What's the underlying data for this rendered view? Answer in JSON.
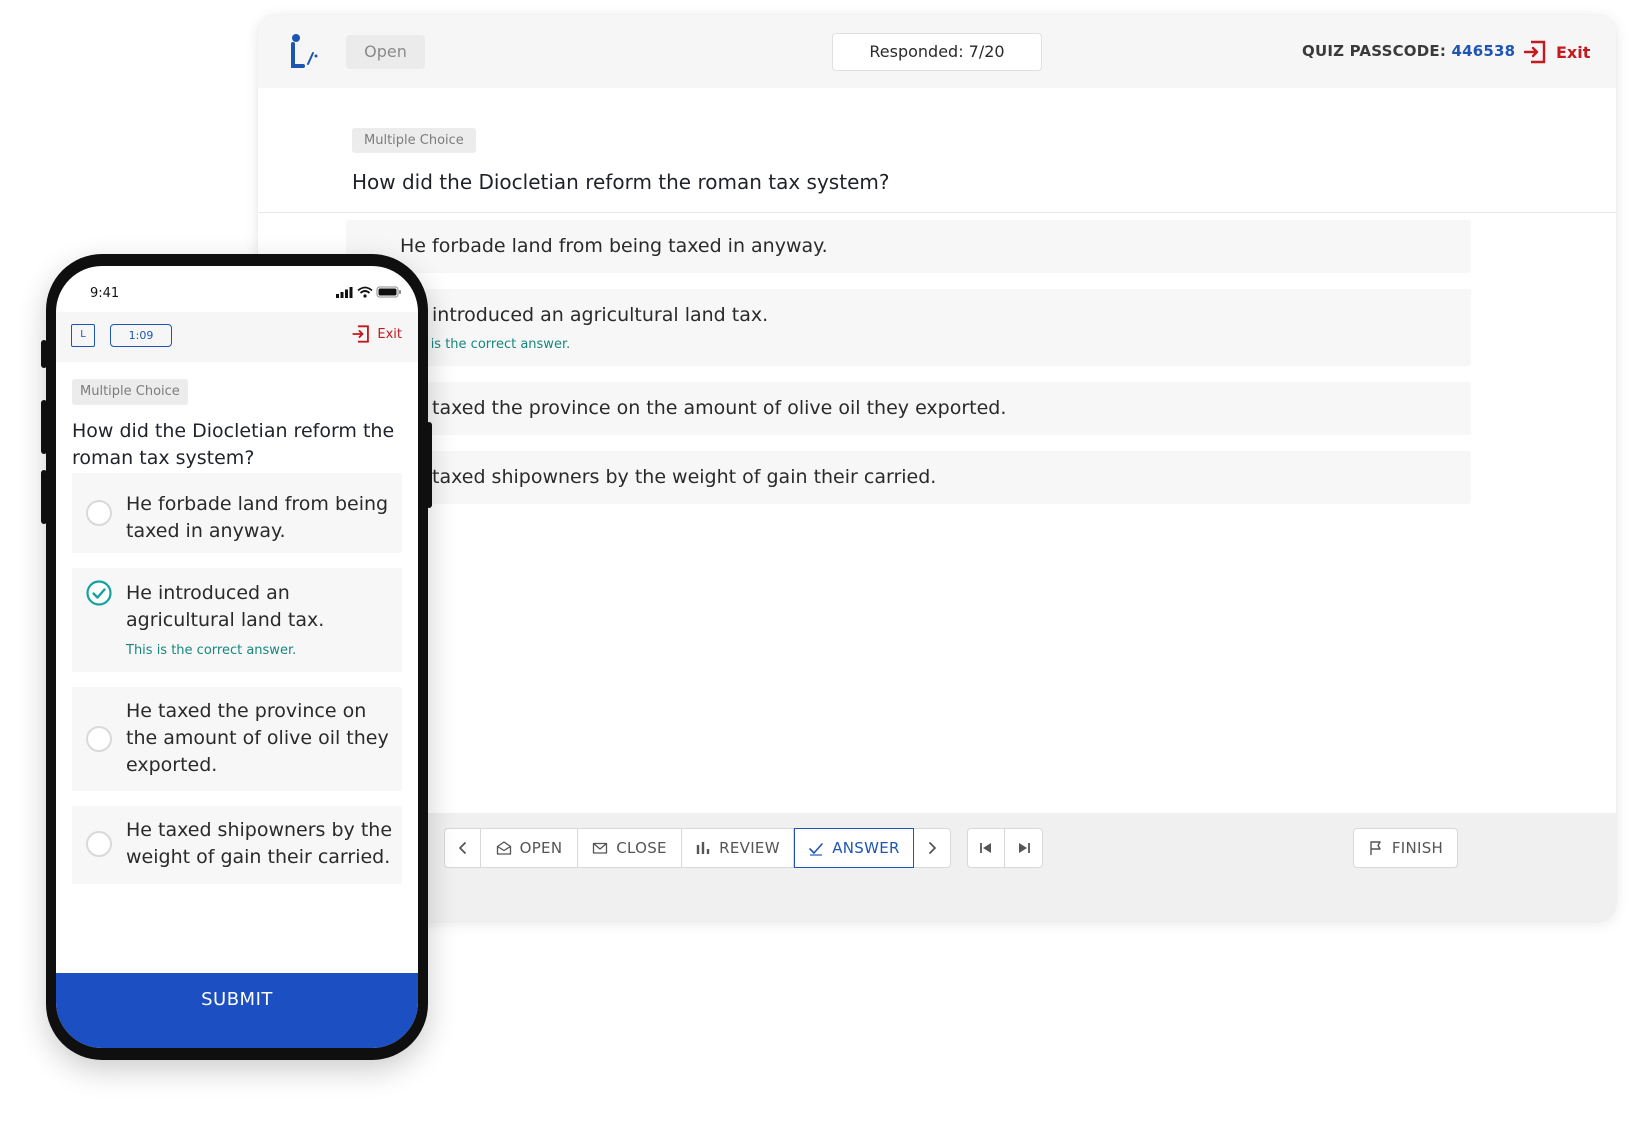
{
  "desktop": {
    "status": "Open",
    "responded": "Responded: 7/20",
    "passcode_label": "QUIZ PASSCODE:",
    "passcode_value": "446538",
    "exit_label": "Exit",
    "question_type": "Multiple Choice",
    "question": "How did the Diocletian reform the roman tax system?",
    "choices": [
      {
        "text": "He forbade land from being taxed in anyway."
      },
      {
        "text": "He introduced an agricultural land tax.",
        "note": "This is the correct answer."
      },
      {
        "text": "He taxed the province on the amount of olive oil they exported."
      },
      {
        "text": "He taxed shipowners by the weight of gain their carried."
      }
    ],
    "toolbar": {
      "open": "OPEN",
      "close": "CLOSE",
      "review": "REVIEW",
      "answer": "ANSWER",
      "finish": "FINISH"
    }
  },
  "phone": {
    "time": "9:41",
    "logo": "L",
    "timer": "1:09",
    "exit_label": "Exit",
    "question_type": "Multiple Choice",
    "question": "How did the Diocletian reform the roman tax system?",
    "choices": [
      {
        "text": "He forbade land from being taxed in anyway.",
        "selected": false
      },
      {
        "text": "He introduced an agricultural land tax.",
        "selected": true,
        "note": "This is the correct answer."
      },
      {
        "text": "He taxed the province on the amount of olive oil they exported.",
        "selected": false
      },
      {
        "text": "He taxed shipowners by the weight of gain their carried.",
        "selected": false
      }
    ],
    "submit": "SUBMIT"
  },
  "colors": {
    "accent": "#1e55b3",
    "exit": "#c4191f",
    "correct": "#16877e",
    "submit": "#1c4fc2"
  }
}
